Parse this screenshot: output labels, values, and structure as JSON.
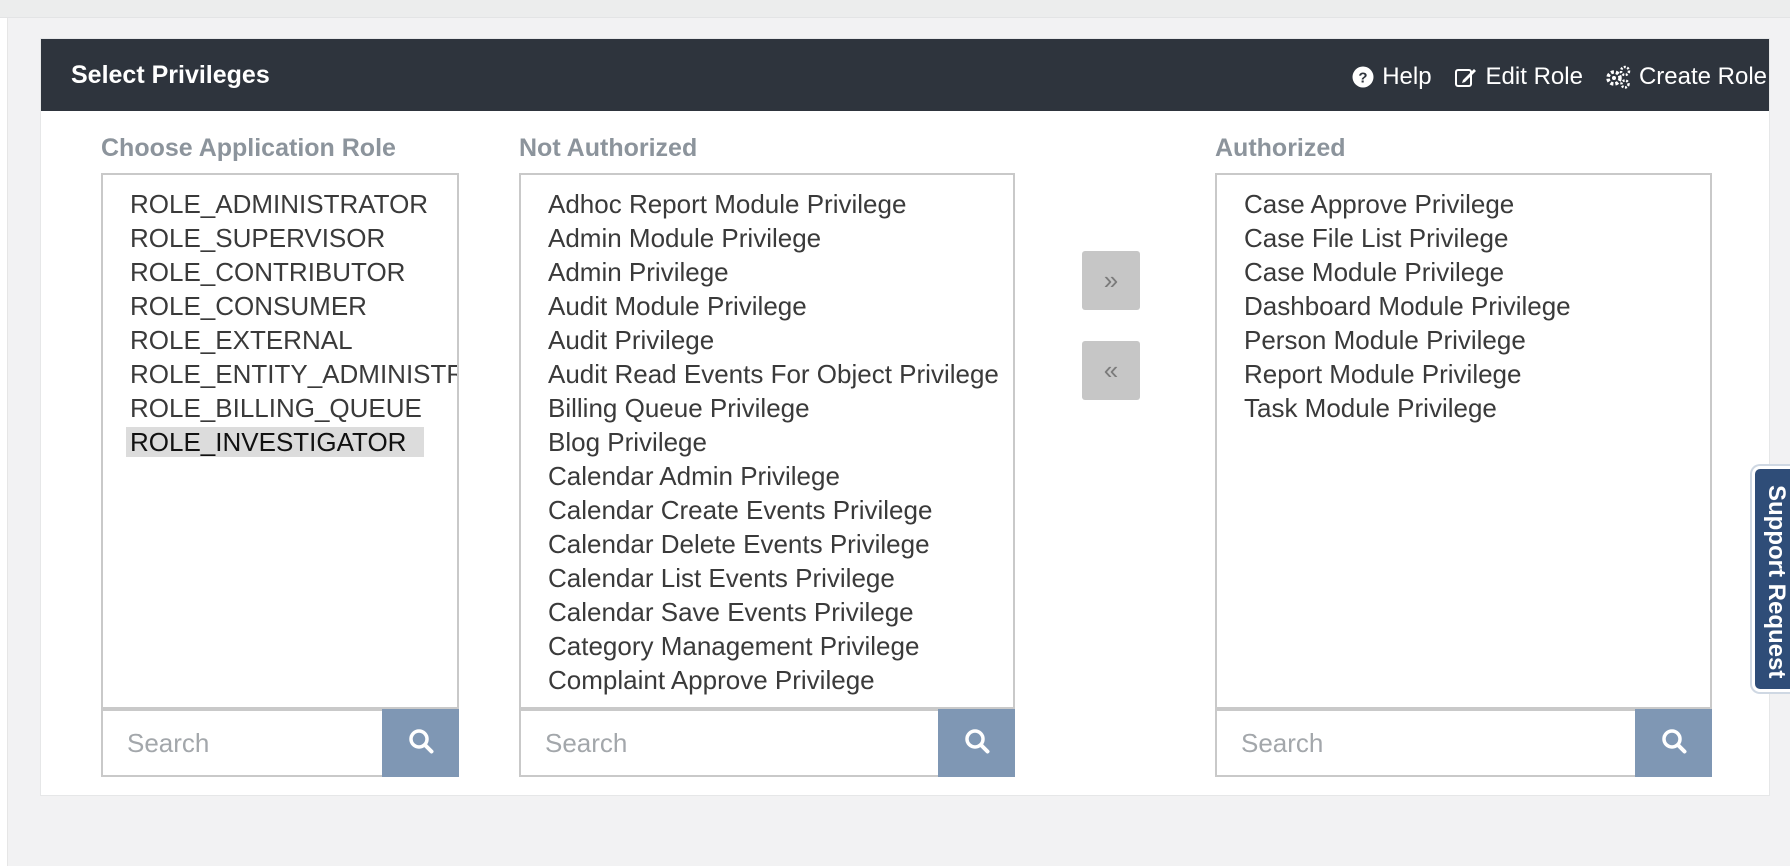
{
  "panel": {
    "title": "Select Privileges",
    "actions": {
      "help": "Help",
      "edit_role": "Edit Role",
      "create_role": "Create Role"
    }
  },
  "roles": {
    "label": "Choose Application Role",
    "items": [
      "ROLE_ADMINISTRATOR",
      "ROLE_SUPERVISOR",
      "ROLE_CONTRIBUTOR",
      "ROLE_CONSUMER",
      "ROLE_EXTERNAL",
      "ROLE_ENTITY_ADMINISTRATOR",
      "ROLE_BILLING_QUEUE",
      "ROLE_INVESTIGATOR"
    ],
    "selected": "ROLE_INVESTIGATOR",
    "search_placeholder": "Search"
  },
  "not_authorized": {
    "label": "Not Authorized",
    "items": [
      "Adhoc Report Module Privilege",
      "Admin Module Privilege",
      "Admin Privilege",
      "Audit Module Privilege",
      "Audit Privilege",
      "Audit Read Events For Object Privilege",
      "Billing Queue Privilege",
      "Blog Privilege",
      "Calendar Admin Privilege",
      "Calendar Create Events Privilege",
      "Calendar Delete Events Privilege",
      "Calendar List Events Privilege",
      "Calendar Save Events Privilege",
      "Category Management Privilege",
      "Complaint Approve Privilege"
    ],
    "search_placeholder": "Search"
  },
  "authorized": {
    "label": "Authorized",
    "items": [
      "Case Approve Privilege",
      "Case File List Privilege",
      "Case Module Privilege",
      "Dashboard Module Privilege",
      "Person Module Privilege",
      "Report Module Privilege",
      "Task Module Privilege"
    ],
    "search_placeholder": "Search"
  },
  "buttons": {
    "authorize": "»",
    "unauthorize": "«"
  },
  "support_tab": "Support Request",
  "colors": {
    "header_bg": "#2e343d",
    "search_button": "#7f97b4",
    "support_tab": "#2f4d78",
    "selected_item": "#dcdcdc"
  }
}
